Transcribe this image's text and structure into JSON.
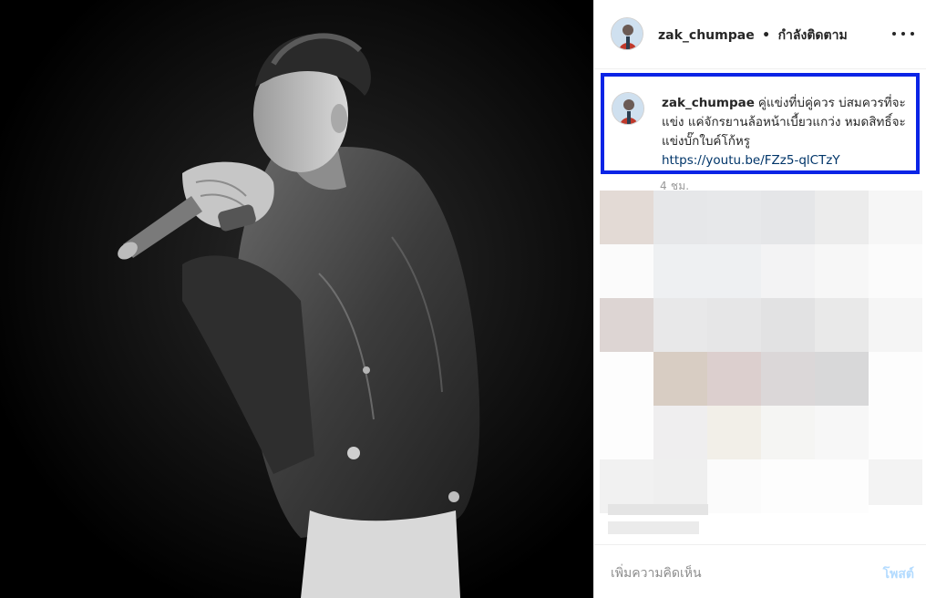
{
  "header": {
    "username": "zak_chumpae",
    "separator": "•",
    "follow_status": "กำลังติดตาม"
  },
  "caption": {
    "username": "zak_chumpae",
    "text": "คู่แข่งที่บ่คู่ควร บ่สมควรที่จะแข่ง แค่จักรยานล้อหน้าเบี้ยวแกว่ง หมดสิทธิ์จะแข่งบั๊กใบค์โก้หรู",
    "link": "https://youtu.be/FZz5-qlCTzY"
  },
  "time": "4 ชม.",
  "comment": {
    "placeholder": "เพิ่มความคิดเห็น",
    "post_label": "โพสต์"
  },
  "icons": {
    "more": "more-options-icon"
  },
  "colors": {
    "highlight_border": "#0a24e6",
    "post_button_disabled": "#b3dbff",
    "photo_background": "#000000"
  }
}
